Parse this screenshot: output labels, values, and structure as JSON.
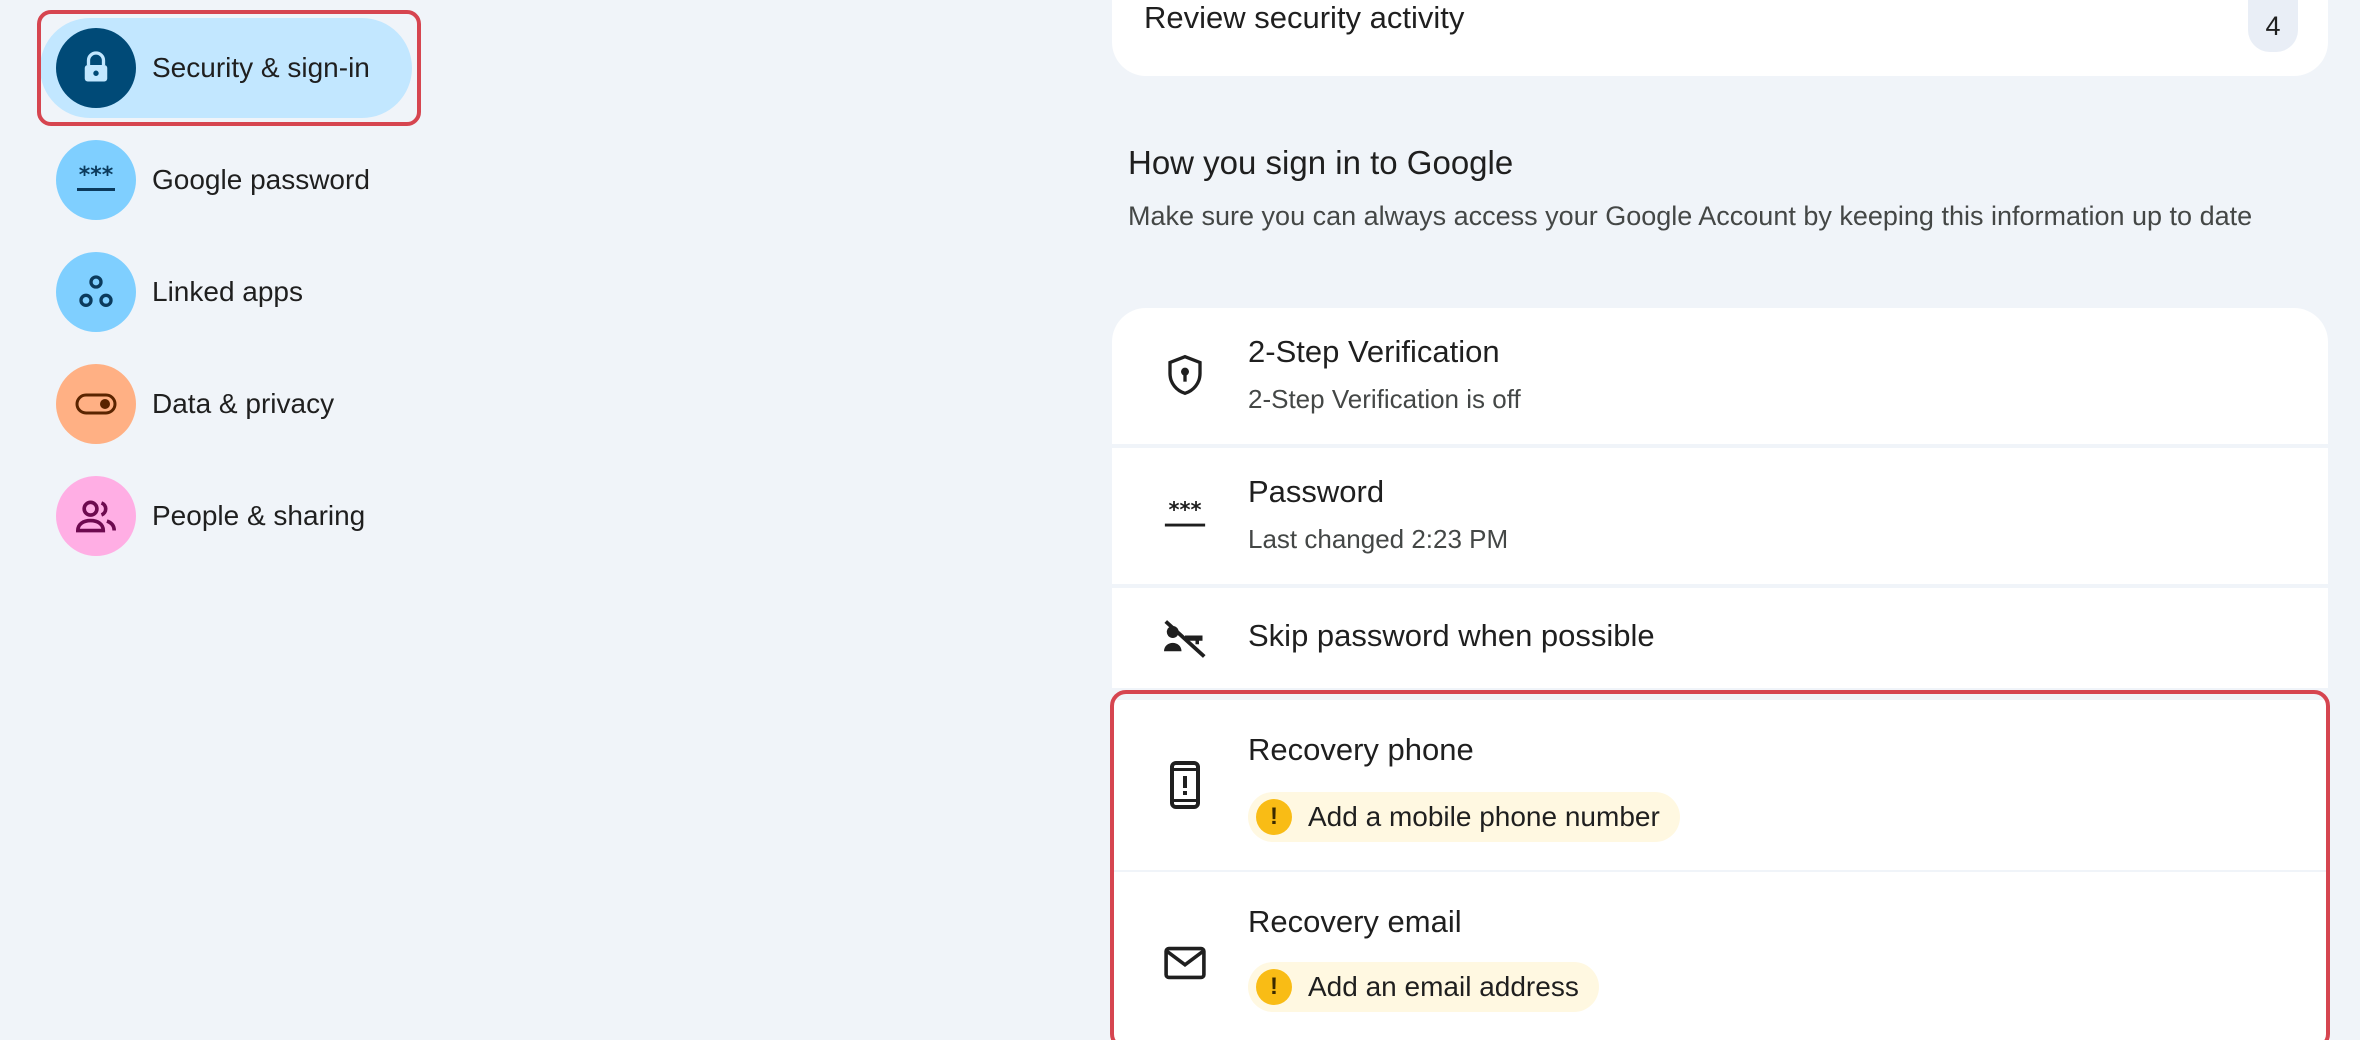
{
  "sidebar": {
    "items": [
      {
        "label": "Security & sign-in",
        "icon": "lock-icon",
        "active": true
      },
      {
        "label": "Google password",
        "icon": "password-dots-icon"
      },
      {
        "label": "Linked apps",
        "icon": "linked-apps-icon"
      },
      {
        "label": "Data & privacy",
        "icon": "toggle-icon"
      },
      {
        "label": "People & sharing",
        "icon": "people-icon"
      }
    ]
  },
  "security_activity": {
    "title": "Review security activity",
    "count": "4"
  },
  "sign_in_section": {
    "heading": "How you sign in to Google",
    "description": "Make sure you can always access your Google Account by keeping this information up to date",
    "rows": [
      {
        "title": "2-Step Verification",
        "subtitle": "2-Step Verification is off",
        "icon": "shield-keyhole-icon"
      },
      {
        "title": "Password",
        "subtitle": "Last changed 2:23 PM",
        "icon": "password-dots-icon"
      },
      {
        "title": "Skip password when possible",
        "icon": "passkey-off-icon"
      },
      {
        "title": "Recovery phone",
        "warning": "Add a mobile phone number",
        "icon": "phone-alert-icon"
      },
      {
        "title": "Recovery email",
        "warning": "Add an email address",
        "icon": "mail-icon"
      }
    ]
  },
  "colors": {
    "page_bg": "#f0f4f9",
    "active_nav_bg": "#c2e7ff",
    "highlight_border": "#d64550",
    "warning_chip_bg": "#fff8e1",
    "warning_dot": "#f9bc15"
  }
}
